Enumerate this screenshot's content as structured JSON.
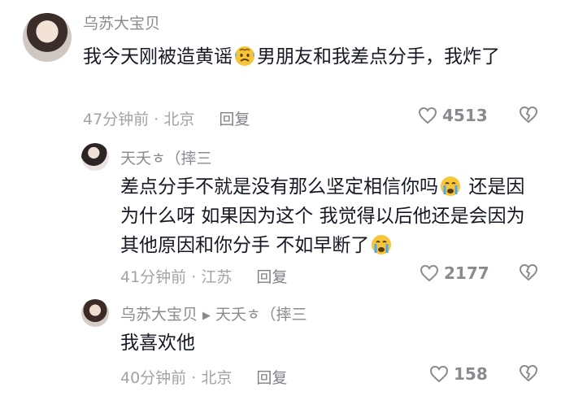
{
  "comments": [
    {
      "username": "乌苏大宝贝",
      "text_before": "我今天刚被造黄谣",
      "text_after": "男朋友和我差点分手，我炸了",
      "time": "47分钟前",
      "location": "北京",
      "reply_label": "回复",
      "likes": "4513"
    },
    {
      "username": "天夭ㅎ（摔三",
      "text_before": "差点分手不就是没有那么坚定相信你吗",
      "text_mid": "还是因为什么呀 如果因为这个 我觉得以后他还是会因为其他原因和你分手 不如早断了",
      "time": "41分钟前",
      "location": "江苏",
      "reply_label": "回复",
      "likes": "2177"
    },
    {
      "username": "乌苏大宝贝",
      "reply_to": "天夭ㅎ（摔三",
      "text": "我喜欢他",
      "time": "40分钟前",
      "location": "北京",
      "reply_label": "回复",
      "likes": "158"
    }
  ],
  "icons": {
    "like": "heart-outline-icon",
    "dislike": "broken-heart-icon",
    "emoji_1": "sweating-emoji",
    "emoji_2": "crying-emoji"
  },
  "colors": {
    "text": "#161823",
    "username": "#8a8b91",
    "meta": "#a2a3a8"
  }
}
